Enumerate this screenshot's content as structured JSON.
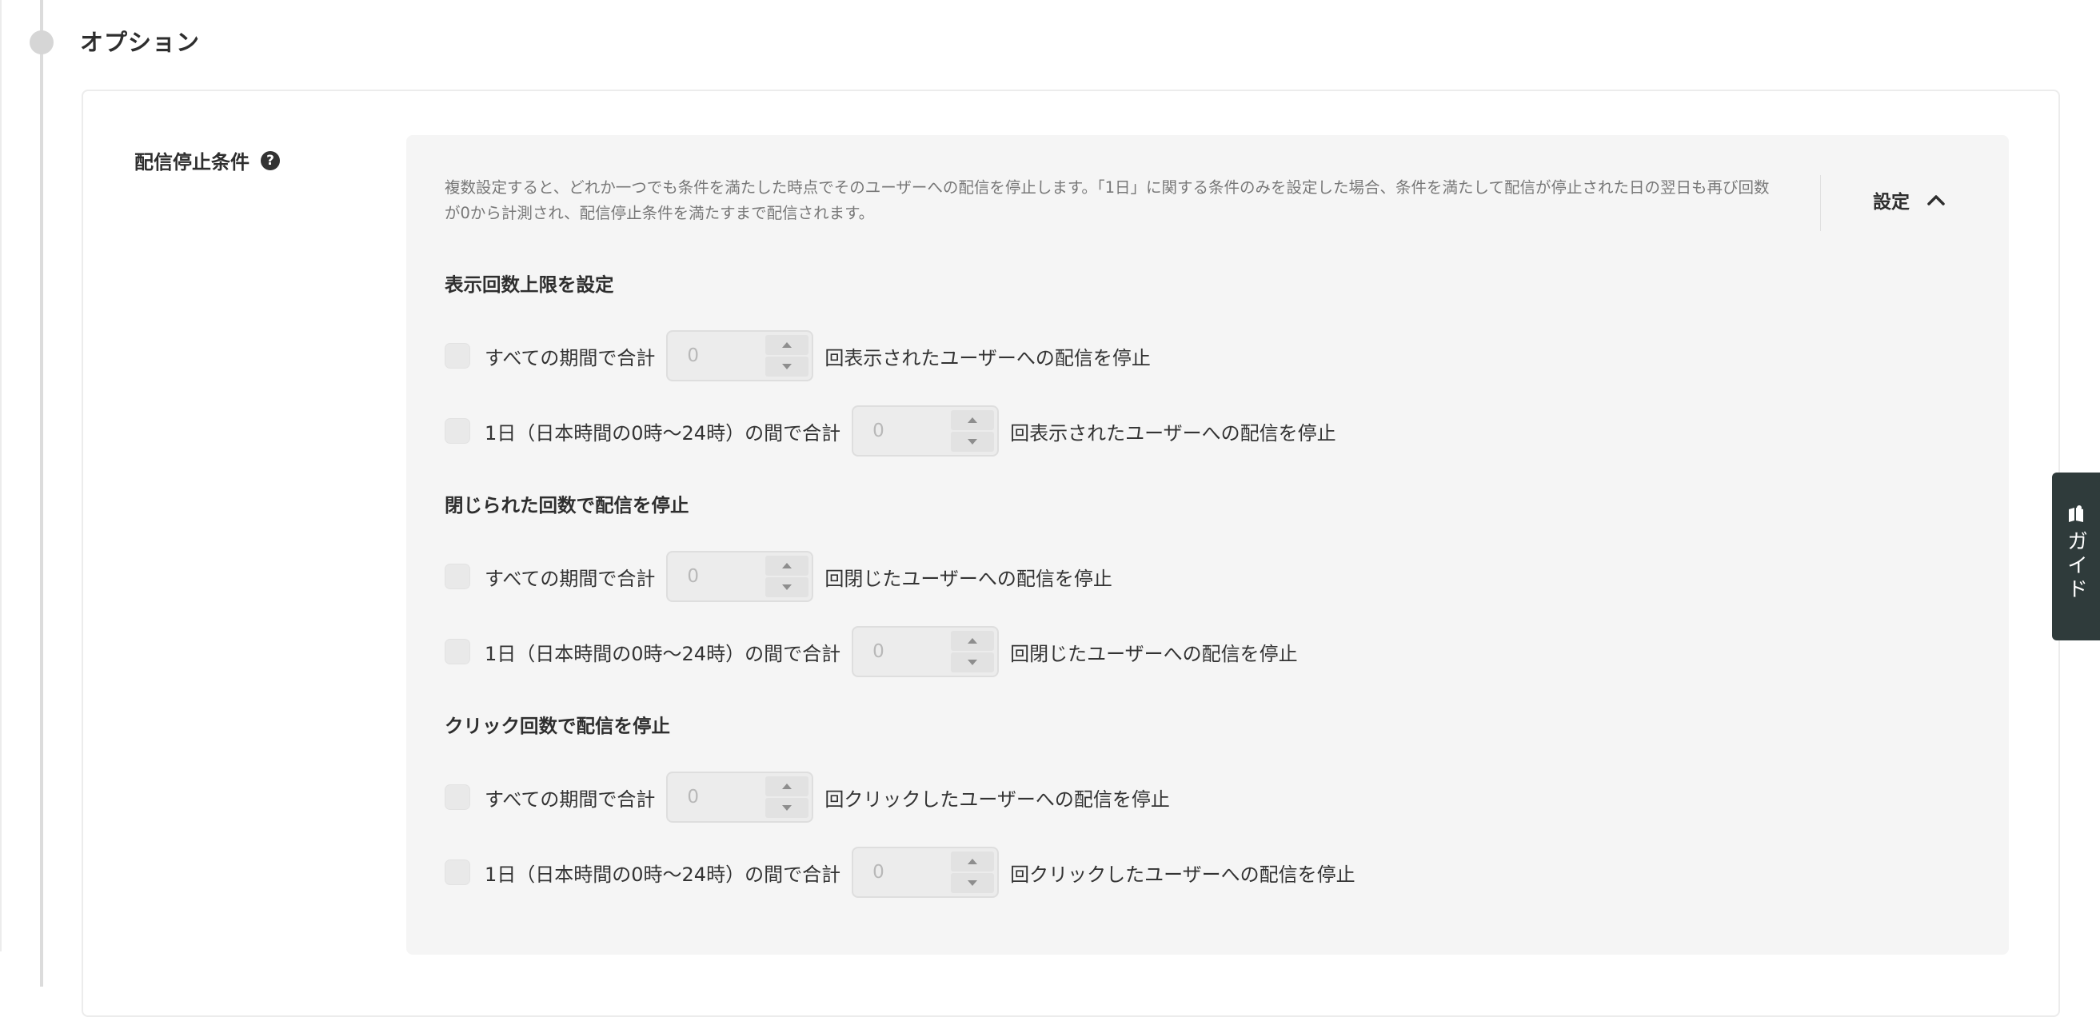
{
  "section": {
    "title": "オプション"
  },
  "field": {
    "label": "配信停止条件",
    "help_icon": "question-circle-icon"
  },
  "panel": {
    "description": "複数設定すると、どれか一つでも条件を満たした時点でそのユーザーへの配信を停止します。「1日」に関する条件のみを設定した場合、条件を満たして配信が停止された日の翌日も再び回数が0から計測され、配信停止条件を満たすまで配信されます。",
    "toggle_label": "設定",
    "toggle_icon": "chevron-up-icon"
  },
  "groups": [
    {
      "title": "表示回数上限を設定",
      "rows": [
        {
          "checked": false,
          "label": "すべての期間で合計",
          "value": "0",
          "suffix": "回表示されたユーザーへの配信を停止"
        },
        {
          "checked": false,
          "label": "1日（日本時間の0時〜24時）の間で合計",
          "value": "0",
          "suffix": "回表示されたユーザーへの配信を停止"
        }
      ]
    },
    {
      "title": "閉じられた回数で配信を停止",
      "rows": [
        {
          "checked": false,
          "label": "すべての期間で合計",
          "value": "0",
          "suffix": "回閉じたユーザーへの配信を停止"
        },
        {
          "checked": false,
          "label": "1日（日本時間の0時〜24時）の間で合計",
          "value": "0",
          "suffix": "回閉じたユーザーへの配信を停止"
        }
      ]
    },
    {
      "title": "クリック回数で配信を停止",
      "rows": [
        {
          "checked": false,
          "label": "すべての期間で合計",
          "value": "0",
          "suffix": "回クリックしたユーザーへの配信を停止"
        },
        {
          "checked": false,
          "label": "1日（日本時間の0時〜24時）の間で合計",
          "value": "0",
          "suffix": "回クリックしたユーザーへの配信を停止"
        }
      ]
    }
  ],
  "guide_tab": {
    "label": "ガイド",
    "icon": "guide-book-icon"
  },
  "colors": {
    "panel_bg": "#f5f5f5",
    "guide_tab_bg": "#2f3b3b",
    "text": "#2e2e2e",
    "muted_text": "#787878"
  }
}
